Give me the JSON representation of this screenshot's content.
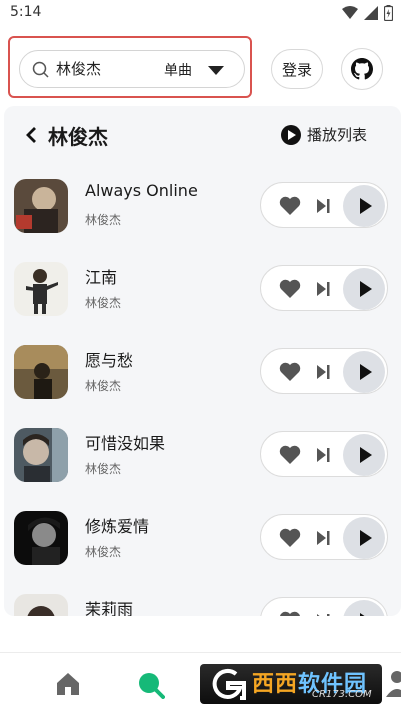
{
  "status_bar": {
    "time": "5:14"
  },
  "search": {
    "query": "林俊杰",
    "type_label": "单曲"
  },
  "header": {
    "login_label": "登录"
  },
  "panel": {
    "artist_name": "林俊杰",
    "playlist_label": "播放列表"
  },
  "songs": [
    {
      "title": "Always Online",
      "artist": "林俊杰"
    },
    {
      "title": "江南",
      "artist": "林俊杰"
    },
    {
      "title": "愿与愁",
      "artist": "林俊杰"
    },
    {
      "title": "可惜没如果",
      "artist": "林俊杰"
    },
    {
      "title": "修炼爱情",
      "artist": "林俊杰"
    },
    {
      "title": "茉莉雨",
      "artist": ""
    }
  ],
  "watermark": {
    "brand_a": "西西",
    "brand_b": "软件园",
    "domain": "CR173.COM"
  },
  "colors": {
    "accent": "#16b978",
    "highlight_border": "#d9534f"
  }
}
